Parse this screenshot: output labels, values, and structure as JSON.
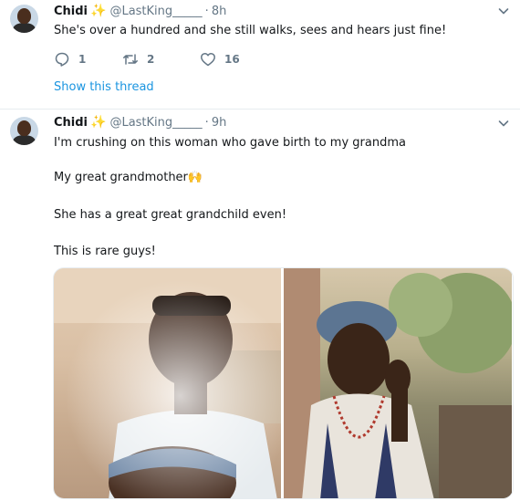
{
  "tweets": [
    {
      "name": "Chidi",
      "name_emoji": "✨",
      "handle": "@LastKing_____",
      "separator": "·",
      "time": "8h",
      "text": "She's over a hundred and she still walks, sees and hears just fine!",
      "actions": {
        "replies": "1",
        "retweets": "2",
        "likes": "16"
      },
      "show_thread": "Show this thread"
    },
    {
      "name": "Chidi",
      "name_emoji": "✨",
      "handle": "@LastKing_____",
      "separator": "·",
      "time": "9h",
      "lines": [
        "I'm crushing on this woman who gave birth to my grandma",
        "My great grandmother",
        "She has a great great grandchild even!",
        "This is rare guys!"
      ],
      "line_emoji": "🙌"
    }
  ],
  "colors": {
    "link": "#1b95e0",
    "secondary_text": "#657786",
    "sparkle": "#f7b500",
    "divider": "#e6ecf0"
  },
  "icons": {
    "reply": "reply-icon",
    "retweet": "retweet-icon",
    "like": "heart-icon",
    "menu": "chevron-down-icon"
  }
}
